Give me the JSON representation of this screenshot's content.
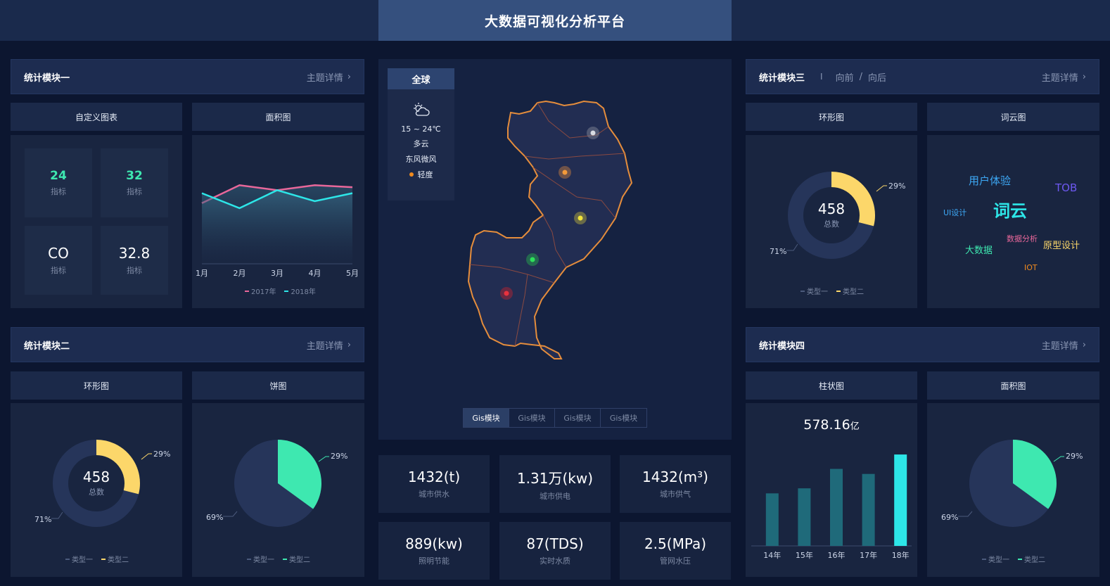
{
  "app_title": "大数据可视化分析平台",
  "module1": {
    "title": "统计模块一",
    "link": "主题详情"
  },
  "module2": {
    "title": "统计模块二",
    "link": "主题详情"
  },
  "module3": {
    "title": "统计模块三",
    "sep": "I",
    "nav_prev": "向前",
    "nav_slash": "/",
    "nav_next": "向后",
    "link": "主题详情"
  },
  "module4": {
    "title": "统计模块四",
    "link": "主题详情"
  },
  "custom_chart": {
    "title": "自定义图表",
    "tiles": [
      {
        "value": "24",
        "label": "指标"
      },
      {
        "value": "32",
        "label": "指标"
      },
      {
        "value": "CO",
        "label": "指标"
      },
      {
        "value": "32.8",
        "label": "指标"
      }
    ]
  },
  "area_chart_1": {
    "title": "面积图",
    "legend": [
      "2017年",
      "2018年"
    ]
  },
  "ring_chart_1": {
    "title": "环形图",
    "center_value": "458",
    "center_label": "总数",
    "pct_a": "29%",
    "pct_b": "71%",
    "legend": [
      "类型一",
      "类型二"
    ]
  },
  "pie_chart_1": {
    "title": "饼图",
    "pct_a": "29%",
    "pct_b": "69%",
    "legend": [
      "类型一",
      "类型二"
    ]
  },
  "ring_chart_2": {
    "title": "环形图",
    "center_value": "458",
    "center_label": "总数",
    "pct_a": "29%",
    "pct_b": "71%",
    "legend": [
      "类型一",
      "类型二"
    ]
  },
  "word_cloud": {
    "title": "词云图",
    "words": [
      "用户体验",
      "TOB",
      "UI设计",
      "词云",
      "数据分析",
      "原型设计",
      "大数据",
      "IOT"
    ]
  },
  "bar_chart": {
    "title": "柱状图",
    "total": "578.16",
    "unit": "亿"
  },
  "area_chart_2": {
    "title": "面积图",
    "pct_a": "29%",
    "pct_b": "69%",
    "legend": [
      "类型一",
      "类型二"
    ]
  },
  "weather": {
    "tab": "全球",
    "temp": "15 ~ 24℃",
    "condition": "多云",
    "wind": "东风微风",
    "air": "轻度"
  },
  "gis_tabs": [
    "Gis模块",
    "Gis模块",
    "Gis模块",
    "Gis模块"
  ],
  "stats": [
    {
      "value": "1432(t)",
      "label": "城市供水"
    },
    {
      "value": "1.31万(kw)",
      "label": "城市供电"
    },
    {
      "value": "1432(m³)",
      "label": "城市供气"
    },
    {
      "value": "889(kw)",
      "label": "照明节能"
    },
    {
      "value": "87(TDS)",
      "label": "实时水质"
    },
    {
      "value": "2.5(MPa)",
      "label": "管网水压"
    }
  ],
  "colors": {
    "pink": "#e8679a",
    "cyan": "#2de6e8",
    "yellow": "#fcd76a",
    "mint": "#3ee8b0",
    "ring_bg": "#26355a"
  },
  "chart_data": [
    {
      "type": "area",
      "categories": [
        "1月",
        "2月",
        "3月",
        "4月",
        "5月"
      ],
      "series": [
        {
          "name": "2017年",
          "values": [
            60,
            78,
            73,
            78,
            76
          ]
        },
        {
          "name": "2018年",
          "values": [
            70,
            55,
            73,
            62,
            70
          ]
        }
      ],
      "ylim": [
        0,
        100
      ]
    },
    {
      "type": "bar",
      "categories": [
        "14年",
        "15年",
        "16年",
        "17年",
        "18年"
      ],
      "values": [
        73,
        80,
        107,
        100,
        127
      ],
      "ylim": [
        0,
        130
      ]
    },
    {
      "type": "pie",
      "categories": [
        "类型一",
        "类型二"
      ],
      "values": [
        71,
        29
      ]
    },
    {
      "type": "pie",
      "categories": [
        "类型一",
        "类型二"
      ],
      "values": [
        69,
        29
      ]
    }
  ]
}
